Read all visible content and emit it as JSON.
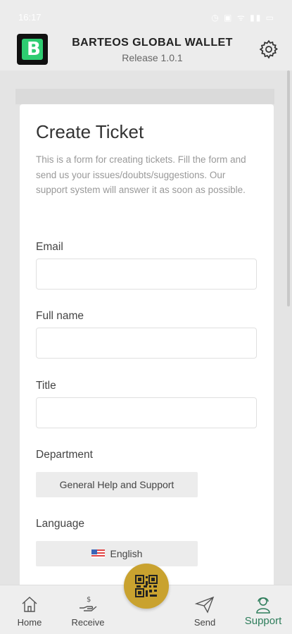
{
  "status": {
    "time": "16:17",
    "icons": "◷ ▣ ᯤ ▮▮ ▭"
  },
  "app": {
    "title": "BARTEOS GLOBAL WALLET",
    "release": "Release 1.0.1",
    "logo_letter": "B",
    "accent": "#c9a22f",
    "active_color": "#2e7d5b"
  },
  "form": {
    "title": "Create Ticket",
    "description": "This is a form for creating tickets. Fill the form and send us your issues/doubts/suggestions. Our support system will answer it as soon as possible.",
    "email": {
      "label": "Email",
      "value": ""
    },
    "full_name": {
      "label": "Full name",
      "value": ""
    },
    "title_field": {
      "label": "Title",
      "value": ""
    },
    "department": {
      "label": "Department",
      "value": "General Help and Support"
    },
    "language": {
      "label": "Language",
      "value": "English",
      "flag_icon": "us-flag-icon"
    }
  },
  "nav": {
    "home": "Home",
    "receive": "Receive",
    "send": "Send",
    "support": "Support",
    "active": "support"
  }
}
